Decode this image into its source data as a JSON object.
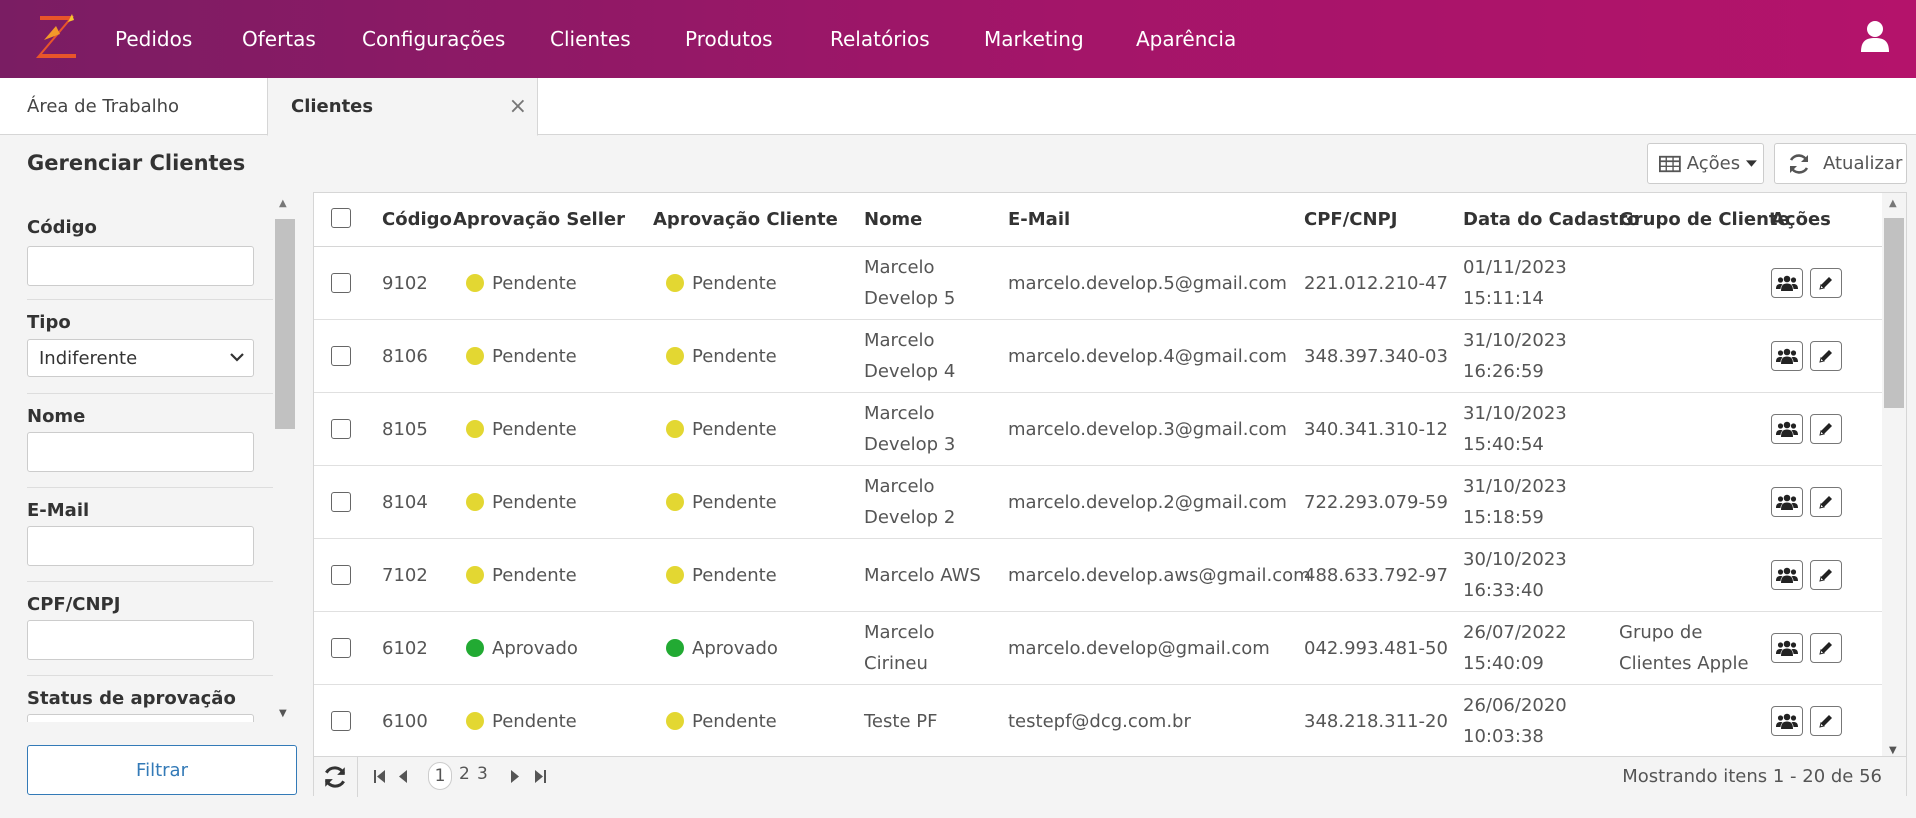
{
  "nav": {
    "items": [
      "Pedidos",
      "Ofertas",
      "Configurações",
      "Clientes",
      "Produtos",
      "Relatórios",
      "Marketing",
      "Aparência"
    ]
  },
  "tabs": {
    "home": "Área de Trabalho",
    "active": "Clientes",
    "close": "×"
  },
  "page": {
    "title": "Gerenciar Clientes",
    "acoes_label": "Ações",
    "atualizar_label": "Atualizar"
  },
  "filters": {
    "codigo_label": "Código",
    "codigo_value": "",
    "tipo_label": "Tipo",
    "tipo_value": "Indiferente",
    "nome_label": "Nome",
    "nome_value": "",
    "email_label": "E-Mail",
    "email_value": "",
    "cpf_label": "CPF/CNPJ",
    "cpf_value": "",
    "status_label": "Status de aprovação",
    "filtrar_label": "Filtrar"
  },
  "grid": {
    "columns": [
      "Código",
      "Aprovação Seller",
      "Aprovação Cliente",
      "Nome",
      "E-Mail",
      "CPF/CNPJ",
      "Data do Cadastro",
      "Grupo de Cliente",
      "Ações"
    ],
    "rows": [
      {
        "codigo": "9102",
        "seller": "Pendente",
        "cliente": "Pendente",
        "nome1": "Marcelo",
        "nome2": "Develop 5",
        "email": "marcelo.develop.5@gmail.com",
        "cpf": "221.012.210-47",
        "data1": "01/11/2023",
        "data2": "15:11:14",
        "grupo1": "",
        "grupo2": ""
      },
      {
        "codigo": "8106",
        "seller": "Pendente",
        "cliente": "Pendente",
        "nome1": "Marcelo",
        "nome2": "Develop 4",
        "email": "marcelo.develop.4@gmail.com",
        "cpf": "348.397.340-03",
        "data1": "31/10/2023",
        "data2": "16:26:59",
        "grupo1": "",
        "grupo2": ""
      },
      {
        "codigo": "8105",
        "seller": "Pendente",
        "cliente": "Pendente",
        "nome1": "Marcelo",
        "nome2": "Develop 3",
        "email": "marcelo.develop.3@gmail.com",
        "cpf": "340.341.310-12",
        "data1": "31/10/2023",
        "data2": "15:40:54",
        "grupo1": "",
        "grupo2": ""
      },
      {
        "codigo": "8104",
        "seller": "Pendente",
        "cliente": "Pendente",
        "nome1": "Marcelo",
        "nome2": "Develop 2",
        "email": "marcelo.develop.2@gmail.com",
        "cpf": "722.293.079-59",
        "data1": "31/10/2023",
        "data2": "15:18:59",
        "grupo1": "",
        "grupo2": ""
      },
      {
        "codigo": "7102",
        "seller": "Pendente",
        "cliente": "Pendente",
        "nome1": "Marcelo AWS",
        "nome2": "",
        "email": "marcelo.develop.aws@gmail.com",
        "cpf": "488.633.792-97",
        "data1": "30/10/2023",
        "data2": "16:33:40",
        "grupo1": "",
        "grupo2": ""
      },
      {
        "codigo": "6102",
        "seller": "Aprovado",
        "cliente": "Aprovado",
        "nome1": "Marcelo",
        "nome2": "Cirineu",
        "email": "marcelo.develop@gmail.com",
        "cpf": "042.993.481-50",
        "data1": "26/07/2022",
        "data2": "15:40:09",
        "grupo1": "Grupo de",
        "grupo2": "Clientes Apple"
      },
      {
        "codigo": "6100",
        "seller": "Pendente",
        "cliente": "Pendente",
        "nome1": "Teste PF",
        "nome2": "",
        "email": "testepf@dcg.com.br",
        "cpf": "348.218.311-20",
        "data1": "26/06/2020",
        "data2": "10:03:38",
        "grupo1": "",
        "grupo2": ""
      }
    ]
  },
  "pager": {
    "pages": [
      "1",
      "2",
      "3"
    ],
    "current": "1",
    "info": "Mostrando itens 1 - 20 de 56"
  },
  "colors": {
    "pending": "#e3d732",
    "approved": "#22aa33",
    "brand_start": "#7a1d63",
    "brand_end": "#b4136b",
    "link": "#337ab7"
  }
}
